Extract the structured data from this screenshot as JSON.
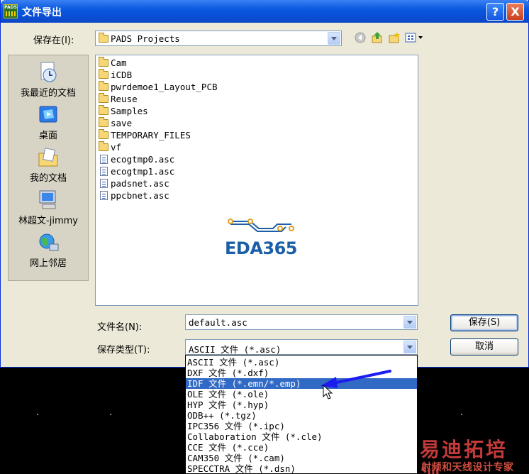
{
  "window": {
    "title": "文件导出",
    "app_icon": "PADS"
  },
  "titlebar": {
    "help_glyph": "?",
    "close_glyph": "X"
  },
  "save_in": {
    "label": "保存在(I):",
    "value": "PADS Projects"
  },
  "toolbar": {
    "back_icon": "back-icon",
    "up_icon": "up-folder-icon",
    "new_folder_icon": "new-folder-icon",
    "views_icon": "views-menu-icon"
  },
  "places": [
    {
      "label": "我最近的文档",
      "icon": "recent-documents-icon"
    },
    {
      "label": "桌面",
      "icon": "desktop-icon"
    },
    {
      "label": "我的文档",
      "icon": "my-documents-icon"
    },
    {
      "label": "林超文-jimmy",
      "icon": "my-computer-icon"
    },
    {
      "label": "网上邻居",
      "icon": "network-places-icon"
    }
  ],
  "files": [
    {
      "name": "Cam",
      "type": "folder"
    },
    {
      "name": "iCDB",
      "type": "folder"
    },
    {
      "name": "pwrdemoe1_Layout_PCB",
      "type": "folder"
    },
    {
      "name": "Reuse",
      "type": "folder"
    },
    {
      "name": "Samples",
      "type": "folder"
    },
    {
      "name": "save",
      "type": "folder"
    },
    {
      "name": "TEMPORARY_FILES",
      "type": "folder"
    },
    {
      "name": "vf",
      "type": "folder"
    },
    {
      "name": "ecogtmp0.asc",
      "type": "file"
    },
    {
      "name": "ecogtmp1.asc",
      "type": "file"
    },
    {
      "name": "padsnet.asc",
      "type": "file"
    },
    {
      "name": "ppcbnet.asc",
      "type": "file"
    }
  ],
  "logo_text": "EDA365",
  "filename": {
    "label": "文件名(N):",
    "value": "default.asc"
  },
  "filetype": {
    "label": "保存类型(T):",
    "value": "ASCII 文件 (*.asc)"
  },
  "buttons": {
    "save": "保存(S)",
    "cancel": "取消"
  },
  "filetype_options": [
    "ASCII 文件 (*.asc)",
    "DXF 文件 (*.dxf)",
    "IDF 文件 (*.emn/*.emp)",
    "OLE 文件 (*.ole)",
    "HYP 文件 (*.hyp)",
    "ODB++ (*.tgz)",
    "IPC356 文件 (*.ipc)",
    "Collaboration 文件 (*.cle)",
    "CCE 文件 (*.cce)",
    "CAM350 文件 (*.cam)",
    "SPECCTRA 文件 (*.dsn)"
  ],
  "selected_option_index": 2,
  "watermark": {
    "line1": "易迪拓培训",
    "line2": "射频和天线设计专家"
  },
  "colors": {
    "selection": "#316ac5",
    "annotation_arrow": "#1c1cf0",
    "titlebar": "#0a4ed6"
  }
}
